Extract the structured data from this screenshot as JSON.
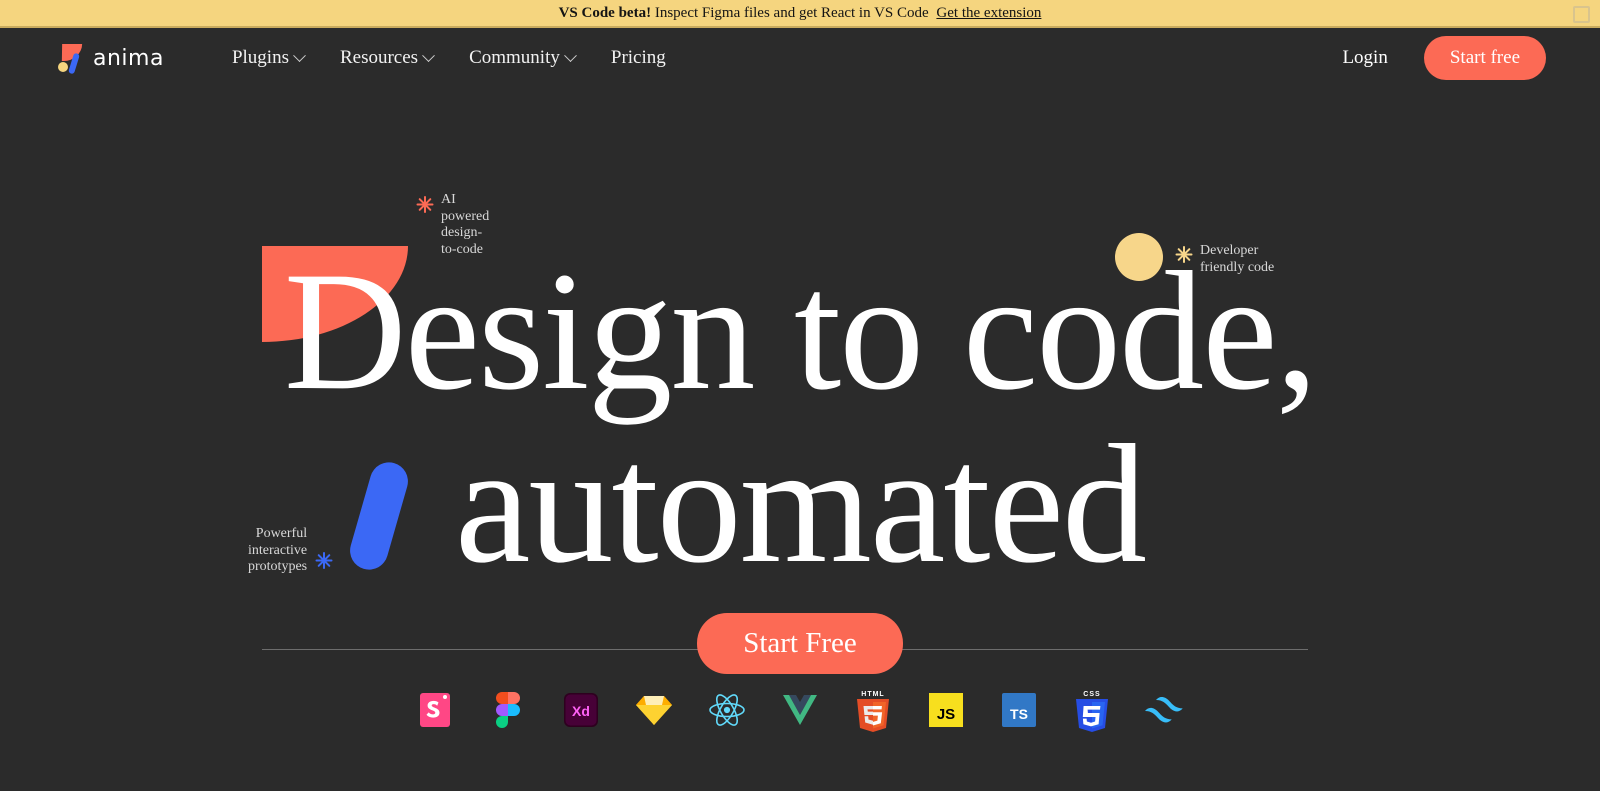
{
  "promo": {
    "strong": "VS Code beta!",
    "message": "Inspect Figma files and get React in VS Code",
    "link_label": "Get the extension",
    "close_icon": "close-icon",
    "background": "#f5d57f"
  },
  "header": {
    "brand_name": "anima",
    "nav": [
      {
        "label": "Plugins",
        "has_dropdown": true
      },
      {
        "label": "Resources",
        "has_dropdown": true
      },
      {
        "label": "Community",
        "has_dropdown": true
      },
      {
        "label": "Pricing",
        "has_dropdown": false
      }
    ],
    "login_label": "Login",
    "cta_label": "Start free"
  },
  "hero": {
    "headline_line1": "Design to code,",
    "headline_line2": "automated",
    "cta_label": "Start Free",
    "annotations": [
      {
        "id": "ai-powered",
        "text": "AI\npowered\ndesign-\nto-code",
        "sparkle_color": "#fc6a55"
      },
      {
        "id": "developer-friendly",
        "text": "Developer\nfriendly code",
        "sparkle_color": "#f7d68a"
      },
      {
        "id": "powerful-prototypes",
        "text": "Powerful\ninteractive\nprototypes",
        "sparkle_color": "#3b68f5"
      }
    ],
    "shapes": [
      {
        "id": "red-wedge",
        "color": "#fc6a55"
      },
      {
        "id": "blue-slash",
        "color": "#3b68f5"
      },
      {
        "id": "yellow-dot",
        "color": "#f7d68a"
      }
    ]
  },
  "logo_strip": [
    {
      "name": "storybook-logo",
      "label": "Storybook",
      "color": "#ff4785"
    },
    {
      "name": "figma-logo",
      "label": "Figma",
      "color": "#f24e1e"
    },
    {
      "name": "adobe-xd-logo",
      "label": "Adobe XD",
      "color": "#470137"
    },
    {
      "name": "sketch-logo",
      "label": "Sketch",
      "color": "#fdad00"
    },
    {
      "name": "react-logo",
      "label": "React",
      "color": "#61dafb"
    },
    {
      "name": "vue-logo",
      "label": "Vue",
      "color": "#41b883"
    },
    {
      "name": "html5-logo",
      "label": "HTML5",
      "color": "#e44d26"
    },
    {
      "name": "javascript-logo",
      "label": "JavaScript",
      "color": "#f7df1e"
    },
    {
      "name": "typescript-logo",
      "label": "TypeScript",
      "color": "#3178c6"
    },
    {
      "name": "css3-logo",
      "label": "CSS3",
      "color": "#264de4"
    },
    {
      "name": "tailwind-logo",
      "label": "Tailwind CSS",
      "color": "#38bdf8"
    }
  ],
  "theme": {
    "background": "#2b2b2b",
    "accent": "#fc6a55",
    "blue": "#3b68f5",
    "yellow": "#f7d68a",
    "divider": "#6d6d6d"
  }
}
